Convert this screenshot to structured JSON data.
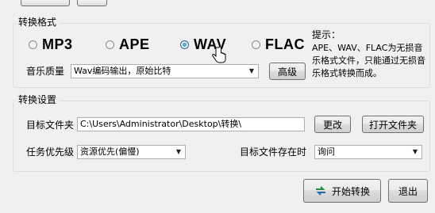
{
  "format_group": {
    "title": "转换格式",
    "formats": [
      {
        "label": "MP3",
        "selected": false
      },
      {
        "label": "APE",
        "selected": false
      },
      {
        "label": "WAV",
        "selected": true
      },
      {
        "label": "FLAC",
        "selected": false
      }
    ],
    "quality_label": "音乐质量",
    "quality_value": "Wav编码输出，原始比特",
    "advanced_button": "高级",
    "hint_title": "提示：",
    "hint_text": "APE、WAV、FLAC为无损音乐格式文件，只能通过无损音乐格式转换而成。"
  },
  "settings_group": {
    "title": "转换设置",
    "target_folder_label": "目标文件夹",
    "target_folder_value": "C:\\Users\\Administrator\\Desktop\\转换\\",
    "change_button": "更改",
    "open_folder_button": "打开文件夹",
    "priority_label": "任务优先级",
    "priority_value": "资源优先(偏慢)",
    "exists_label": "目标文件存在时",
    "exists_value": "询问"
  },
  "footer": {
    "start_button": "开始转换",
    "exit_button": "退出"
  },
  "colors": {
    "accent": "#1b6fb5",
    "group_border": "#d5dfe5"
  }
}
